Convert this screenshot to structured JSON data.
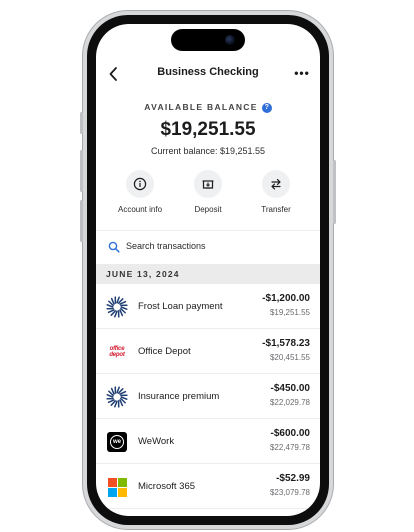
{
  "header": {
    "title": "Business Checking",
    "back_icon": "chevron-left-icon",
    "more_icon": "more-horizontal-icon"
  },
  "balance": {
    "label": "AVAILABLE BALANCE",
    "info_badge": "?",
    "amount": "$19,251.55",
    "current_label": "Current balance: $19,251.55"
  },
  "actions": [
    {
      "label": "Account info",
      "icon": "info-icon"
    },
    {
      "label": "Deposit",
      "icon": "deposit-check-icon"
    },
    {
      "label": "Transfer",
      "icon": "transfer-arrows-icon"
    }
  ],
  "search": {
    "placeholder": "Search transactions",
    "icon": "search-icon"
  },
  "transactions": {
    "date": "JUNE 13, 2024",
    "items": [
      {
        "name": "Frost Loan payment",
        "amount": "-$1,200.00",
        "balance": "$19,251.55",
        "logo": "frost-starburst-logo"
      },
      {
        "name": "Office Depot",
        "amount": "-$1,578.23",
        "balance": "$20,451.55",
        "logo": "office-depot-logo",
        "logo_text": [
          "office",
          "depot"
        ]
      },
      {
        "name": "Insurance premium",
        "amount": "-$450.00",
        "balance": "$22,029.78",
        "logo": "frost-starburst-logo"
      },
      {
        "name": "WeWork",
        "amount": "-$600.00",
        "balance": "$22,479.78",
        "logo": "wework-logo",
        "logo_text": "we"
      },
      {
        "name": "Microsoft 365",
        "amount": "-$52.99",
        "balance": "$23,079.78",
        "logo": "microsoft-logo"
      }
    ]
  },
  "colors": {
    "accent_blue": "#2f6fd6",
    "frost_navy": "#1f3f73",
    "office_depot_red": "#d2182e",
    "microsoft": [
      "#f25022",
      "#7fba00",
      "#00a4ef",
      "#ffb900"
    ]
  }
}
